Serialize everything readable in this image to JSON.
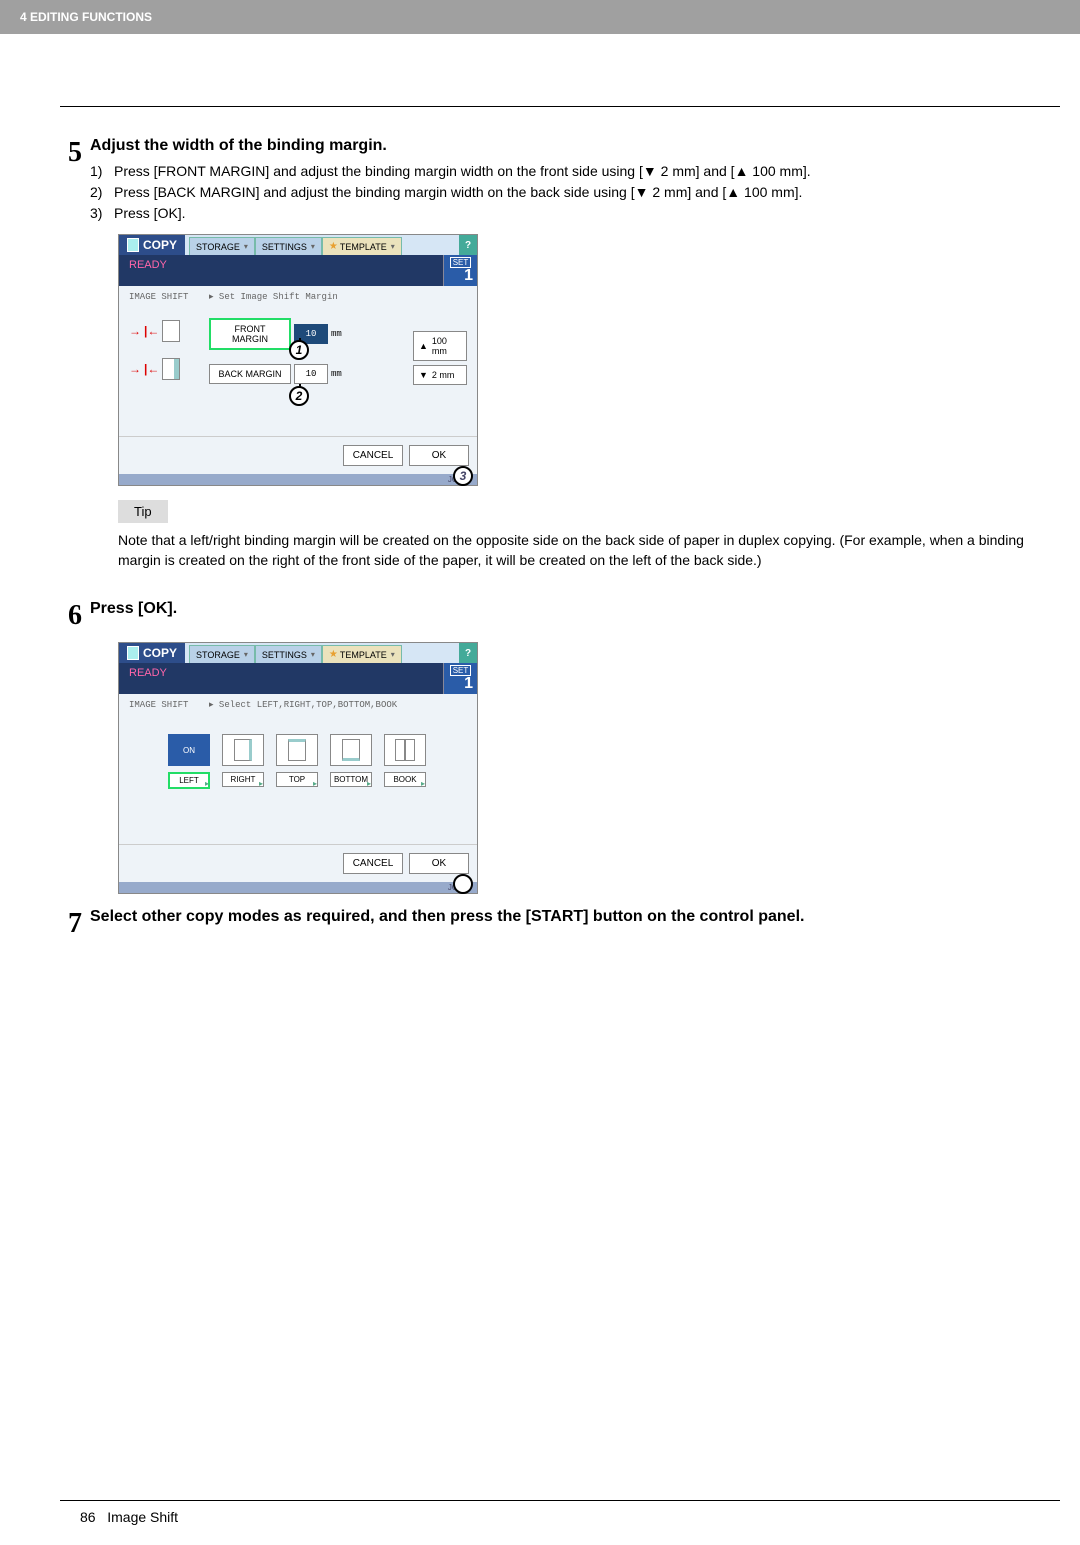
{
  "header": {
    "chapter": "4  EDITING FUNCTIONS"
  },
  "step5": {
    "num": "5",
    "title": "Adjust the width of the binding margin.",
    "sub1": {
      "n": "1)",
      "text_a": "Press [FRONT MARGIN] and adjust the binding margin width on the front side using [",
      "down": "▼",
      "text_b": " 2 mm] and [",
      "up": "▲",
      "text_c": " 100 mm]."
    },
    "sub2": {
      "n": "2)",
      "text_a": "Press [BACK MARGIN] and adjust the binding margin width on the back side using [",
      "down": "▼",
      "text_b": " 2 mm] and [",
      "up": "▲",
      "text_c": " 100 mm]."
    },
    "sub3": {
      "n": "3)",
      "text": "Press [OK]."
    }
  },
  "screenshot1": {
    "copy": "COPY",
    "tabs": {
      "storage": "STORAGE",
      "settings": "SETTINGS",
      "template": "TEMPLATE"
    },
    "help": "?",
    "ready": "READY",
    "set": "SET",
    "count": "1",
    "instr_l": "IMAGE SHIFT",
    "instr_r": "Set Image Shift Margin",
    "front_label": "FRONT MARGIN",
    "front_val": "10",
    "back_label": "BACK MARGIN",
    "back_val": "10",
    "unit": "mm",
    "up_btn": "100 mm",
    "down_btn": "2 mm",
    "cancel": "CANCEL",
    "ok": "OK",
    "job": "JOB S",
    "callout1": "1",
    "callout2": "2",
    "callout3": "3"
  },
  "tip": {
    "label": "Tip",
    "text": "Note that a left/right binding margin will be created on the opposite side on the back side of paper in duplex copying. (For example, when a binding margin is created on the right of the front side of the paper, it will be created on the left of the back side.)"
  },
  "step6": {
    "num": "6",
    "title": "Press [OK]."
  },
  "screenshot2": {
    "copy": "COPY",
    "tabs": {
      "storage": "STORAGE",
      "settings": "SETTINGS",
      "template": "TEMPLATE"
    },
    "help": "?",
    "ready": "READY",
    "set": "SET",
    "count": "1",
    "instr_l": "IMAGE SHIFT",
    "instr_r": "Select LEFT,RIGHT,TOP,BOTTOM,BOOK",
    "on": "ON",
    "left": "LEFT",
    "right": "RIGHT",
    "top": "TOP",
    "bottom": "BOTTOM",
    "book": "BOOK",
    "cancel": "CANCEL",
    "ok": "OK",
    "job": "JOB S"
  },
  "step7": {
    "num": "7",
    "title": "Select other copy modes as required, and then press the [START] button on the control panel."
  },
  "footer": {
    "page": "86",
    "section": "Image Shift"
  }
}
